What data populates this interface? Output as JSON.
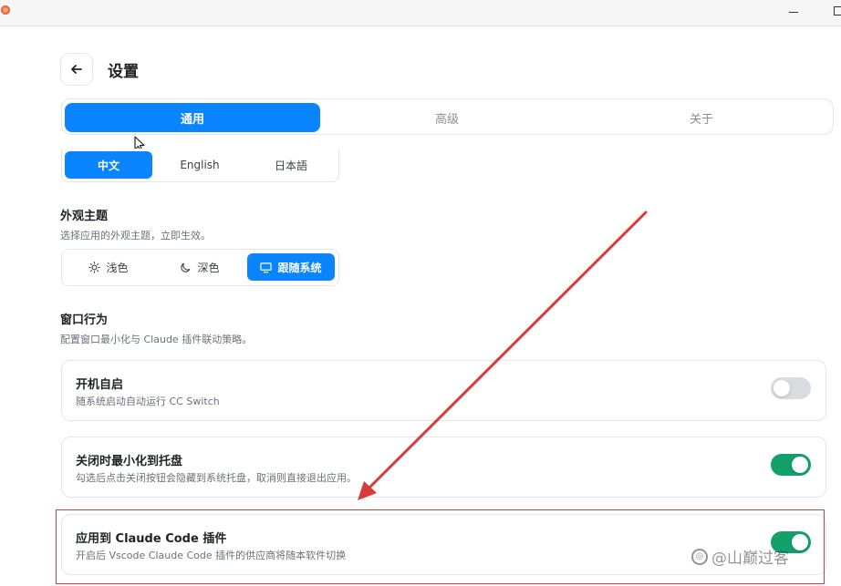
{
  "header": {
    "title": "设置"
  },
  "tabs": [
    {
      "label": "通用",
      "active": true
    },
    {
      "label": "高级",
      "active": false
    },
    {
      "label": "关于",
      "active": false
    }
  ],
  "language": {
    "options": [
      {
        "label": "中文",
        "active": true
      },
      {
        "label": "English",
        "active": false
      },
      {
        "label": "日本語",
        "active": false
      }
    ]
  },
  "appearance": {
    "title": "外观主题",
    "description": "选择应用的外观主题，立即生效。",
    "options": [
      {
        "label": "浅色",
        "icon": "sun-icon",
        "active": false
      },
      {
        "label": "深色",
        "icon": "moon-icon",
        "active": false
      },
      {
        "label": "跟随系统",
        "icon": "monitor-icon",
        "active": true
      }
    ]
  },
  "window_behavior": {
    "title": "窗口行为",
    "description": "配置窗口最小化与 Claude 插件联动策略。",
    "items": [
      {
        "title": "开机自启",
        "description": "随系统启动自动运行 CC Switch",
        "enabled": false
      },
      {
        "title": "关闭时最小化到托盘",
        "description": "勾选后点击关闭按钮会隐藏到系统托盘，取消则直接退出应用。",
        "enabled": true
      },
      {
        "title": "应用到 Claude Code 插件",
        "description": "开启后 Vscode Claude Code 插件的供应商将随本软件切换",
        "enabled": true
      }
    ]
  },
  "watermark": {
    "text": "@山巅过客"
  },
  "colors": {
    "accent": "#0a84ff",
    "toggle_on": "#13a06b",
    "annotation": "#d93a3a"
  }
}
